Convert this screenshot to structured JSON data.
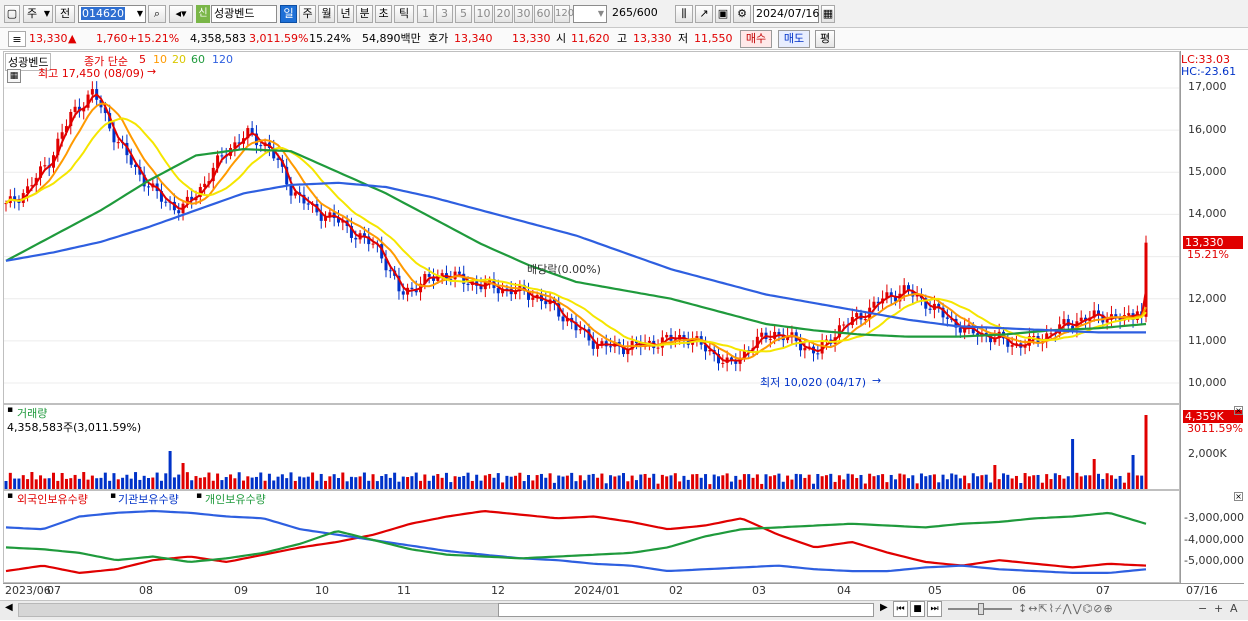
{
  "toolbar": {
    "period_left": "주",
    "prev_label": "전",
    "code": "014620",
    "stock_name": "성광벤드",
    "new_tag": "신",
    "periods": [
      "일",
      "주",
      "월",
      "년",
      "분",
      "초",
      "틱"
    ],
    "active_period": "일",
    "intervals": [
      "1",
      "3",
      "5",
      "10",
      "20",
      "30",
      "60",
      "120"
    ],
    "count": "265",
    "count_total": "/600",
    "date": "2024/07/16"
  },
  "quote": {
    "price": "13,330",
    "change_arrow": "▲",
    "change": "1,760",
    "change_pct": "+15.21%",
    "volume": "4,358,583",
    "volume_ratio": "3,011.59%",
    "turnover": "15.24%",
    "amount": "54,890백만",
    "bid_label": "호가",
    "bid": "13,340",
    "ask": "13,330",
    "open_label": "시",
    "open": "11,620",
    "high_label": "고",
    "high": "13,330",
    "low_label": "저",
    "low": "11,550",
    "buy_label": "매수",
    "sell_label": "매도",
    "eval_label": "평"
  },
  "price_panel": {
    "legend_name": "성광벤드",
    "legend_close": "종가 단순",
    "ma_labels": [
      "5",
      "10",
      "20",
      "60",
      "120"
    ],
    "ma_colors": [
      "#e00000",
      "#ff9a00",
      "#f5e600",
      "#1f9a3c",
      "#2e5fe0"
    ],
    "high_note": "최고 17,450 (08/09)",
    "low_note": "최저 10,020 (04/17)",
    "dividend_note": "배당락(0.00%)",
    "lc_label": "LC:33.03",
    "hc_label": "HC:-23.61",
    "price_badge": "13,330",
    "pct_badge": "15.21%",
    "ticks": [
      "17,000",
      "16,000",
      "15,000",
      "14,000",
      "13,000",
      "12,000",
      "11,000",
      "10,000"
    ]
  },
  "volume_panel": {
    "title": "거래량",
    "value_text": "4,358,583주(3,011.59%)",
    "badge": "4,359K",
    "pct": "3011.59%",
    "tick": "2,000K"
  },
  "holdings_panel": {
    "legend": [
      "외국인보유수량",
      "기관보유수량",
      "개인보유수량"
    ],
    "legend_colors": [
      "#e00000",
      "#2e5fe0",
      "#1f9a3c"
    ],
    "ticks": [
      "-3,000,000",
      "-4,000,000",
      "-5,000,000"
    ]
  },
  "xaxis": {
    "labels": [
      "2023/06",
      "07",
      "08",
      "09",
      "10",
      "11",
      "12",
      "2024/01",
      "02",
      "03",
      "04",
      "05",
      "06",
      "07"
    ],
    "right_label": "07/16"
  },
  "chart_data": {
    "type": "line",
    "title": "성광벤드",
    "x": [
      "2023/06",
      "2023/07",
      "2023/08",
      "2023/09",
      "2023/10",
      "2023/11",
      "2023/12",
      "2024/01",
      "2024/02",
      "2024/03",
      "2024/04",
      "2024/05",
      "2024/06",
      "2024/07"
    ],
    "series": [
      {
        "name": "종가",
        "values": [
          14200,
          14900,
          16800,
          15400,
          14100,
          13000,
          12400,
          12100,
          11000,
          10900,
          10700,
          11900,
          11200,
          13330
        ]
      },
      {
        "name": "120",
        "values": [
          12900,
          13300,
          13800,
          14300,
          14700,
          14700,
          14300,
          13900,
          13200,
          12500,
          12000,
          11600,
          11300,
          11200
        ]
      }
    ],
    "ylim": [
      10000,
      17000
    ],
    "high": {
      "value": 17450,
      "date": "08/09"
    },
    "low": {
      "value": 10020,
      "date": "04/17"
    }
  }
}
